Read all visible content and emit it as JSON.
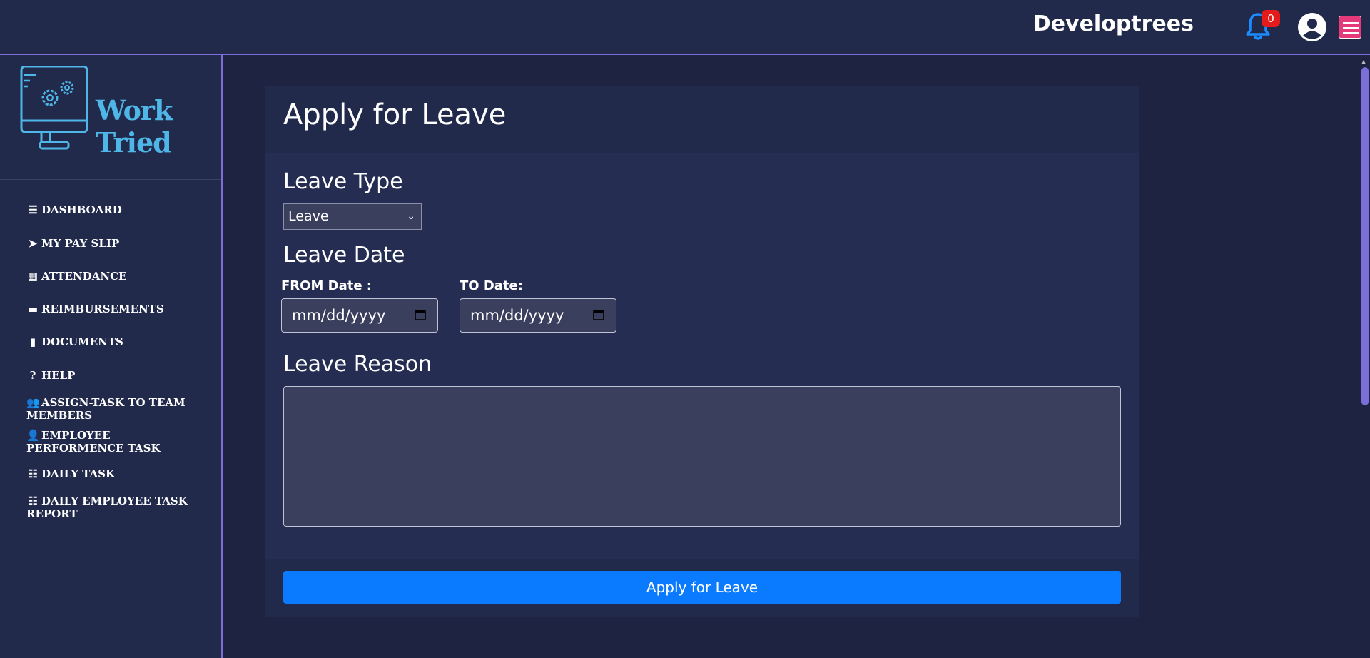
{
  "header": {
    "brand": "Developtrees",
    "notification_count": "0"
  },
  "sidebar": {
    "logo_text": "Work Tried",
    "items": [
      {
        "label": "DASHBOARD",
        "icon": "bars-icon"
      },
      {
        "label": "MY PAY SLIP",
        "icon": "paper-plane-icon"
      },
      {
        "label": "ATTENDANCE",
        "icon": "calendar-icon"
      },
      {
        "label": "REIMBURSEMENTS",
        "icon": "credit-card-icon"
      },
      {
        "label": "DOCUMENTS",
        "icon": "file-icon"
      },
      {
        "label": "HELP",
        "icon": "question-circle-icon"
      },
      {
        "label": "ASSIGN-TASK TO TEAM MEMBERS",
        "icon": "users-icon"
      },
      {
        "label": "EMPLOYEE PERFORMENCE TASK",
        "icon": "user-edit-icon"
      },
      {
        "label": "DAILY TASK",
        "icon": "list-check-icon"
      },
      {
        "label": "DAILY EMPLOYEE TASK REPORT",
        "icon": "list-check-icon"
      }
    ]
  },
  "form": {
    "title": "Apply for Leave",
    "leave_type_label": "Leave Type",
    "leave_type_value": "Leave",
    "leave_date_label": "Leave Date",
    "from_label": "FROM Date :",
    "to_label": "TO Date:",
    "from_placeholder": "mm/dd/yyyy",
    "to_placeholder": "mm/dd/yyyy",
    "reason_label": "Leave Reason",
    "reason_value": "",
    "submit_label": "Apply for Leave"
  },
  "colors": {
    "accent": "#0a7bff",
    "sidebar_bg": "#222a4c",
    "page_bg": "#1e2341",
    "border_accent": "#7b6fd9",
    "badge": "#e51b1b"
  }
}
